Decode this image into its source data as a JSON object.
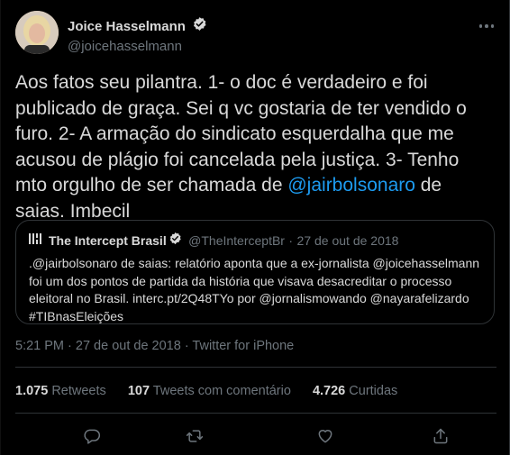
{
  "author": {
    "name": "Joice Hasselmann",
    "handle": "@joicehasselmann"
  },
  "tweet": {
    "text_parts": [
      "Aos fatos seu pilantra. 1- o doc é verdadeiro e foi publicado de graça. Sei q vc gostaria de ter vendido o furo. 2- A armação do sindicato esquerdalha que me acusou de plágio foi cancelada pela justiça. 3- Tenho mto orgulho de ser chamada de ",
      "@jairbolsonaro",
      " de saias. Imbecil"
    ]
  },
  "quoted": {
    "name": "The Intercept Brasil",
    "handle": "@TheInterceptBr",
    "separator": "·",
    "date": "27 de out de 2018",
    "text": ".@jairbolsonaro de saias: relatório aponta que a ex-jornalista @joicehasselmann foi um dos pontos de partida da história que visava desacreditar o processo eleitoral no Brasil. interc.pt/2Q48TYo por @jornalismowando @nayarafelizardo #TIBnasEleições"
  },
  "meta": {
    "text": "5:21 PM · 27 de out de 2018 · Twitter for iPhone"
  },
  "stats": {
    "retweets_count": "1.075",
    "retweets_label": "Retweets",
    "quotes_count": "107",
    "quotes_label": "Tweets com comentário",
    "likes_count": "4.726",
    "likes_label": "Curtidas"
  },
  "colors": {
    "background": "#000000",
    "text": "#d9d9d9",
    "secondary": "#6e767d",
    "accent": "#1d9bf0",
    "border": "#2f3336"
  },
  "icons": [
    "verified-badge-icon",
    "more-options-icon",
    "reply-icon",
    "retweet-icon",
    "like-icon",
    "share-icon",
    "intercept-logo-icon"
  ]
}
